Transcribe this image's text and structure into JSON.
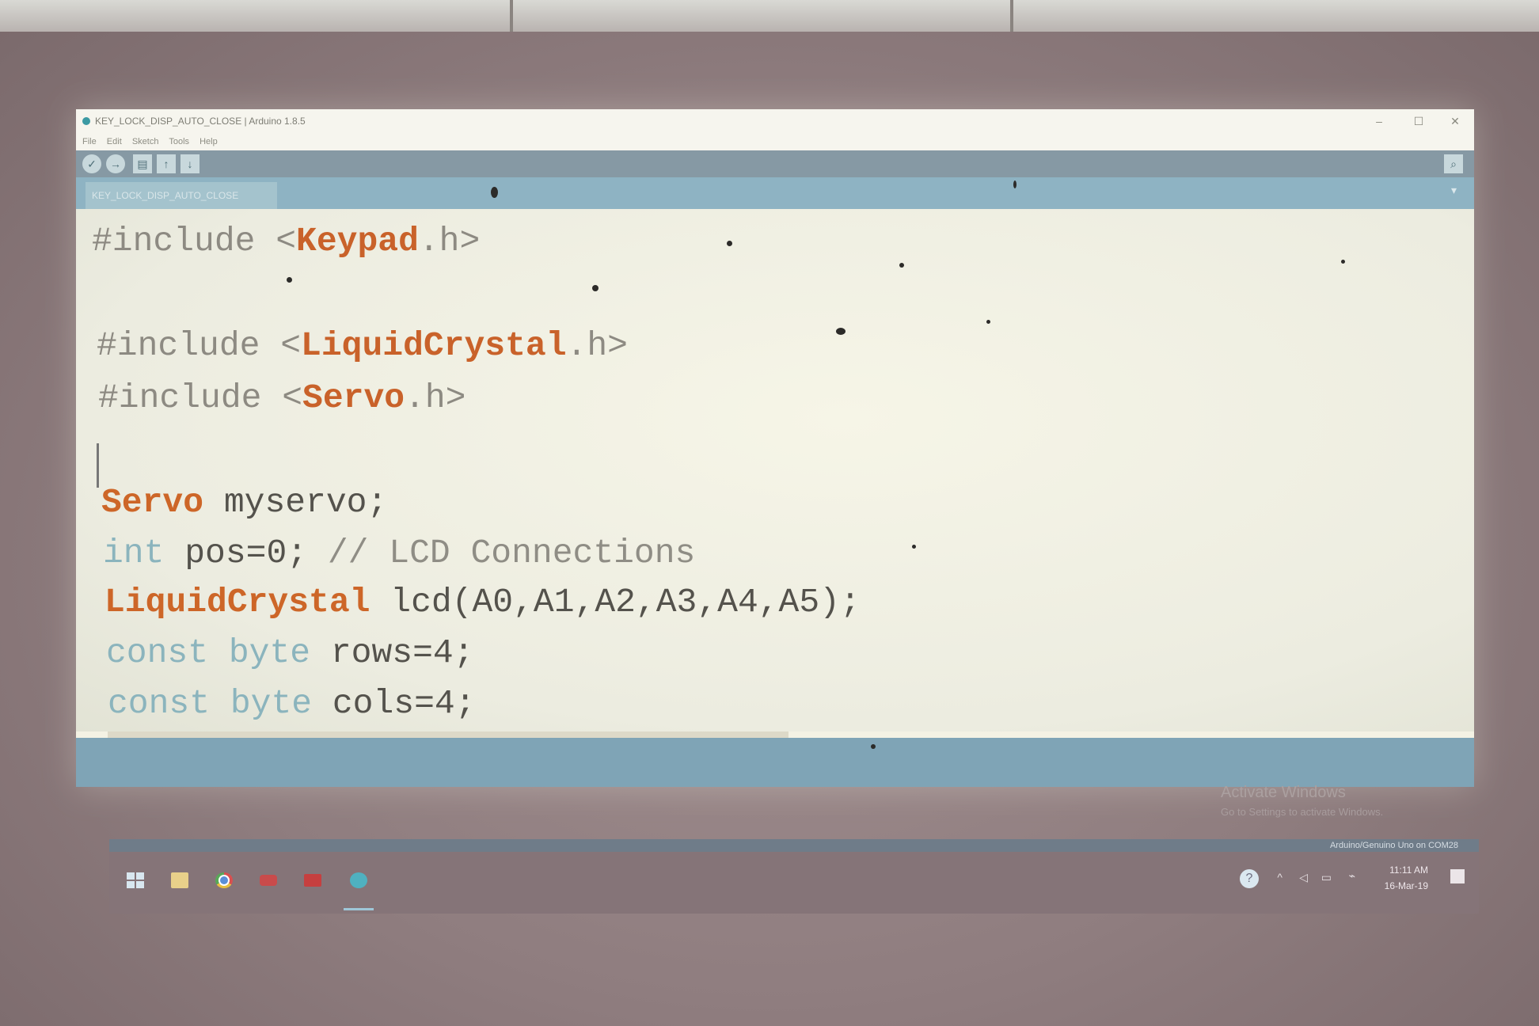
{
  "window": {
    "title": "KEY_LOCK_DISP_AUTO_CLOSE | Arduino 1.8.5",
    "controls": {
      "minimize": "–",
      "maximize": "☐",
      "close": "✕"
    }
  },
  "menu": {
    "items": [
      "File",
      "Edit",
      "Sketch",
      "Tools",
      "Help"
    ]
  },
  "toolbar": {
    "verify_icon": "✓",
    "upload_icon": "→",
    "new_icon": "▤",
    "open_icon": "↑",
    "save_icon": "↓",
    "serial_monitor_icon": "⌕"
  },
  "tabs": {
    "active": "KEY_LOCK_DISP_AUTO_CLOSE",
    "menu_icon": "▾"
  },
  "editor": {
    "line1": {
      "directive": "#include",
      "open": " <",
      "lib": "Keypad",
      "close": ".h>"
    },
    "line2": {
      "directive": "#include",
      "open": " <",
      "lib": "LiquidCrystal",
      "close": ".h>"
    },
    "line3": {
      "directive": "#include",
      "open": " <",
      "lib": "Servo",
      "close": ".h>"
    },
    "line4": {
      "type": "Servo",
      "rest": " myservo;"
    },
    "line5": {
      "type": "int",
      "rest": " pos=0; ",
      "comment": "// LCD Connections"
    },
    "line6": {
      "type": "LiquidCrystal",
      "rest": " lcd(A0,A1,A2,A3,A4,A5);"
    },
    "line7": {
      "kw1": "const",
      "kw2": " byte",
      "rest": " rows=4;"
    },
    "line8": {
      "kw1": "const",
      "kw2": " byte",
      "rest": " cols=4;"
    }
  },
  "watermark": {
    "title": "Activate Windows",
    "subtitle": "Go to Settings to activate Windows."
  },
  "statusbar": {
    "board": "Arduino/Genuino Uno on COM28"
  },
  "taskbar": {
    "apps": [
      "windows-start",
      "file-explorer",
      "chrome",
      "youtube",
      "mail",
      "arduino"
    ],
    "clock_time": "11:11 AM",
    "clock_date": "16-Mar-19"
  }
}
